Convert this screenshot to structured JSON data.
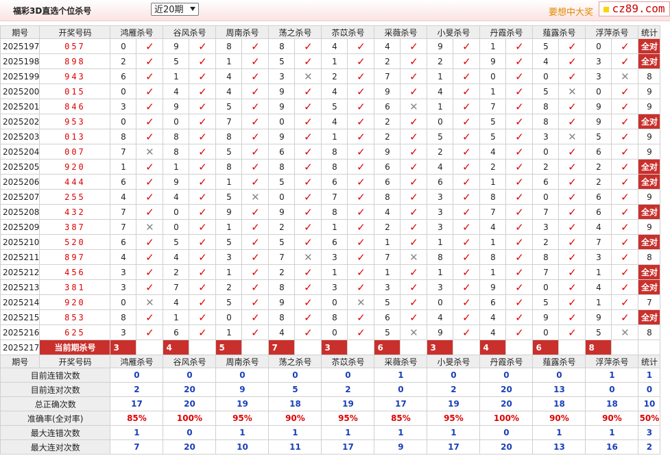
{
  "header": {
    "title": "福彩3D直选个位杀号",
    "period_select": "近20期",
    "slogan": "要想中大奖",
    "logo": "cz89.com"
  },
  "columns": {
    "period": "期号",
    "winning": "开奖号码",
    "stat": "统计",
    "experts": [
      "鸿雁杀号",
      "谷风杀号",
      "周南杀号",
      "荡之杀号",
      "苶苡杀号",
      "采薇杀号",
      "小旻杀号",
      "丹霞杀号",
      "薤露杀号",
      "浮萍杀号"
    ]
  },
  "rows": [
    {
      "p": "2025197",
      "w": "057",
      "k": [
        "0",
        "9",
        "8",
        "8",
        "4",
        "4",
        "9",
        "1",
        "5",
        "0"
      ],
      "r": "1111111111",
      "s": "全对"
    },
    {
      "p": "2025198",
      "w": "898",
      "k": [
        "2",
        "5",
        "1",
        "5",
        "1",
        "2",
        "2",
        "9",
        "4",
        "3"
      ],
      "r": "1111111111",
      "s": "全对"
    },
    {
      "p": "2025199",
      "w": "943",
      "k": [
        "6",
        "1",
        "4",
        "3",
        "2",
        "7",
        "1",
        "0",
        "0",
        "3"
      ],
      "r": "1110111110",
      "s": "8"
    },
    {
      "p": "2025200",
      "w": "015",
      "k": [
        "0",
        "4",
        "4",
        "9",
        "4",
        "9",
        "4",
        "1",
        "5",
        "0"
      ],
      "r": "1111111101",
      "s": "9"
    },
    {
      "p": "2025201",
      "w": "846",
      "k": [
        "3",
        "9",
        "5",
        "9",
        "5",
        "6",
        "1",
        "7",
        "8",
        "9"
      ],
      "r": "1111101111",
      "s": "9"
    },
    {
      "p": "2025202",
      "w": "953",
      "k": [
        "0",
        "0",
        "7",
        "0",
        "4",
        "2",
        "0",
        "5",
        "8",
        "9"
      ],
      "r": "1111111111",
      "s": "全对"
    },
    {
      "p": "2025203",
      "w": "013",
      "k": [
        "8",
        "8",
        "8",
        "9",
        "1",
        "2",
        "5",
        "5",
        "3",
        "5"
      ],
      "r": "1111111101",
      "s": "9"
    },
    {
      "p": "2025204",
      "w": "007",
      "k": [
        "7",
        "8",
        "5",
        "6",
        "8",
        "9",
        "2",
        "4",
        "0",
        "6"
      ],
      "r": "0111111111",
      "s": "9"
    },
    {
      "p": "2025205",
      "w": "920",
      "k": [
        "1",
        "1",
        "8",
        "8",
        "8",
        "6",
        "4",
        "2",
        "2",
        "2"
      ],
      "r": "1111111111",
      "s": "全对"
    },
    {
      "p": "2025206",
      "w": "444",
      "k": [
        "6",
        "9",
        "1",
        "5",
        "6",
        "6",
        "6",
        "1",
        "6",
        "2"
      ],
      "r": "1111111111",
      "s": "全对"
    },
    {
      "p": "2025207",
      "w": "255",
      "k": [
        "4",
        "4",
        "5",
        "0",
        "7",
        "8",
        "3",
        "8",
        "0",
        "6"
      ],
      "r": "1101111111",
      "s": "9"
    },
    {
      "p": "2025208",
      "w": "432",
      "k": [
        "7",
        "0",
        "9",
        "9",
        "8",
        "4",
        "3",
        "7",
        "7",
        "6"
      ],
      "r": "1111111111",
      "s": "全对"
    },
    {
      "p": "2025209",
      "w": "387",
      "k": [
        "7",
        "0",
        "1",
        "2",
        "1",
        "2",
        "3",
        "4",
        "3",
        "4"
      ],
      "r": "0111111111",
      "s": "9"
    },
    {
      "p": "2025210",
      "w": "520",
      "k": [
        "6",
        "5",
        "5",
        "5",
        "6",
        "1",
        "1",
        "1",
        "2",
        "7"
      ],
      "r": "1111111111",
      "s": "全对"
    },
    {
      "p": "2025211",
      "w": "897",
      "k": [
        "4",
        "4",
        "3",
        "7",
        "3",
        "7",
        "8",
        "8",
        "8",
        "3"
      ],
      "r": "1110101111",
      "s": "8"
    },
    {
      "p": "2025212",
      "w": "456",
      "k": [
        "3",
        "2",
        "1",
        "2",
        "1",
        "1",
        "1",
        "1",
        "7",
        "1"
      ],
      "r": "1111111111",
      "s": "全对"
    },
    {
      "p": "2025213",
      "w": "381",
      "k": [
        "3",
        "7",
        "2",
        "8",
        "3",
        "3",
        "3",
        "9",
        "0",
        "4"
      ],
      "r": "1111111111",
      "s": "全对"
    },
    {
      "p": "2025214",
      "w": "920",
      "k": [
        "0",
        "4",
        "5",
        "9",
        "0",
        "5",
        "0",
        "6",
        "5",
        "1"
      ],
      "r": "0111011111",
      "s": "7"
    },
    {
      "p": "2025215",
      "w": "853",
      "k": [
        "8",
        "1",
        "0",
        "8",
        "8",
        "6",
        "4",
        "4",
        "9",
        "9"
      ],
      "r": "1111111111",
      "s": "全对"
    },
    {
      "p": "2025216",
      "w": "625",
      "k": [
        "3",
        "6",
        "1",
        "4",
        "0",
        "5",
        "9",
        "4",
        "0",
        "5"
      ],
      "r": "1111101110",
      "s": "8"
    }
  ],
  "current": {
    "p": "2025217",
    "label": "当前期杀号",
    "k": [
      "3",
      "4",
      "5",
      "7",
      "3",
      "6",
      "3",
      "4",
      "6",
      "8"
    ]
  },
  "summary": [
    {
      "label": "目前连错次数",
      "v": [
        "0",
        "0",
        "0",
        "0",
        "0",
        "1",
        "0",
        "0",
        "0",
        "1"
      ],
      "t": "1",
      "red": false
    },
    {
      "label": "目前连对次数",
      "v": [
        "2",
        "20",
        "9",
        "5",
        "2",
        "0",
        "2",
        "20",
        "13",
        "0"
      ],
      "t": "0",
      "red": false
    },
    {
      "label": "总正确次数",
      "v": [
        "17",
        "20",
        "19",
        "18",
        "19",
        "17",
        "19",
        "20",
        "18",
        "18"
      ],
      "t": "10",
      "red": false
    },
    {
      "label": "准确率(全对率)",
      "v": [
        "85%",
        "100%",
        "95%",
        "90%",
        "95%",
        "85%",
        "95%",
        "100%",
        "90%",
        "90%"
      ],
      "t": "50%",
      "red": true
    },
    {
      "label": "最大连错次数",
      "v": [
        "1",
        "0",
        "1",
        "1",
        "1",
        "1",
        "1",
        "0",
        "1",
        "1"
      ],
      "t": "3",
      "red": false
    },
    {
      "label": "最大连对次数",
      "v": [
        "7",
        "20",
        "10",
        "11",
        "17",
        "9",
        "17",
        "20",
        "13",
        "16"
      ],
      "t": "2",
      "red": false
    }
  ]
}
